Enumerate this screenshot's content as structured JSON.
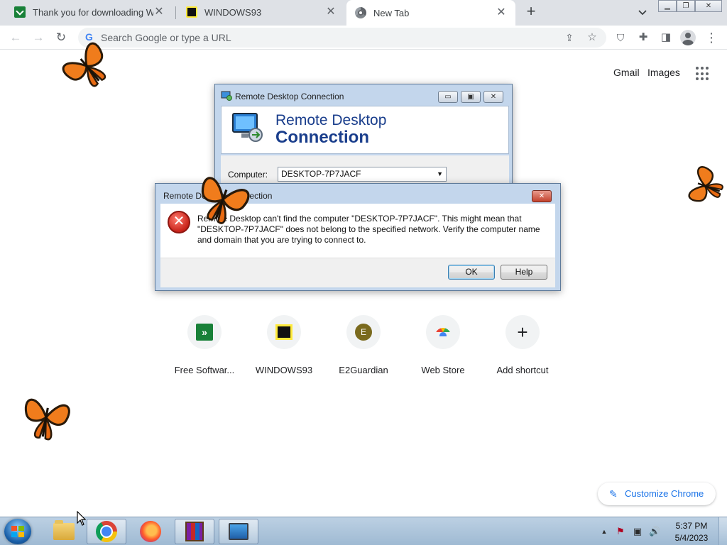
{
  "browser": {
    "tabs": [
      {
        "title": "Thank you for downloading WinR",
        "favicon": "free-software-icon",
        "active": false
      },
      {
        "title": "WINDOWS93",
        "favicon": "windows93-icon",
        "active": false
      },
      {
        "title": "New Tab",
        "favicon": "chrome-icon",
        "active": true
      }
    ],
    "new_tab_symbol": "+",
    "close_symbol": "✕",
    "omnibox": {
      "placeholder": "Search Google or type a URL",
      "google_g": "G"
    }
  },
  "ntp": {
    "links": {
      "gmail": "Gmail",
      "images": "Images"
    },
    "shortcuts": [
      {
        "label": "Free Softwar...",
        "icon": "free-software-icon",
        "glyph": "»"
      },
      {
        "label": "WINDOWS93",
        "icon": "windows93-icon",
        "glyph": ""
      },
      {
        "label": "E2Guardian",
        "icon": "e2guardian-icon",
        "glyph": "E"
      },
      {
        "label": "Web Store",
        "icon": "web-store-icon",
        "glyph": ""
      },
      {
        "label": "Add shortcut",
        "icon": "plus-icon",
        "glyph": "+"
      }
    ],
    "customize_label": "Customize Chrome"
  },
  "rdc_window": {
    "title": "Remote Desktop Connection",
    "banner_line1": "Remote Desktop",
    "banner_line2": "Connection",
    "computer_label": "Computer:",
    "computer_value": "DESKTOP-7P7JACF"
  },
  "error_dialog": {
    "title": "Remote Desktop Connection",
    "message": "Remote Desktop can't find the computer \"DESKTOP-7P7JACF\". This might mean that \"DESKTOP-7P7JACF\" does not belong to the specified network.  Verify the computer name and domain that you are trying to connect to.",
    "ok_label": "OK",
    "help_label": "Help",
    "icon": "error-icon"
  },
  "taskbar": {
    "apps": [
      "windows-explorer",
      "google-chrome",
      "firefox",
      "winrar",
      "remote-desktop-connection"
    ],
    "clock_time": "5:37 PM",
    "clock_date": "5/4/2023"
  },
  "colors": {
    "link_blue": "#1a73e8",
    "rdc_title_blue": "#1a3e8c",
    "error_red": "#c8231a",
    "taskbar": "#bcd0e3"
  }
}
